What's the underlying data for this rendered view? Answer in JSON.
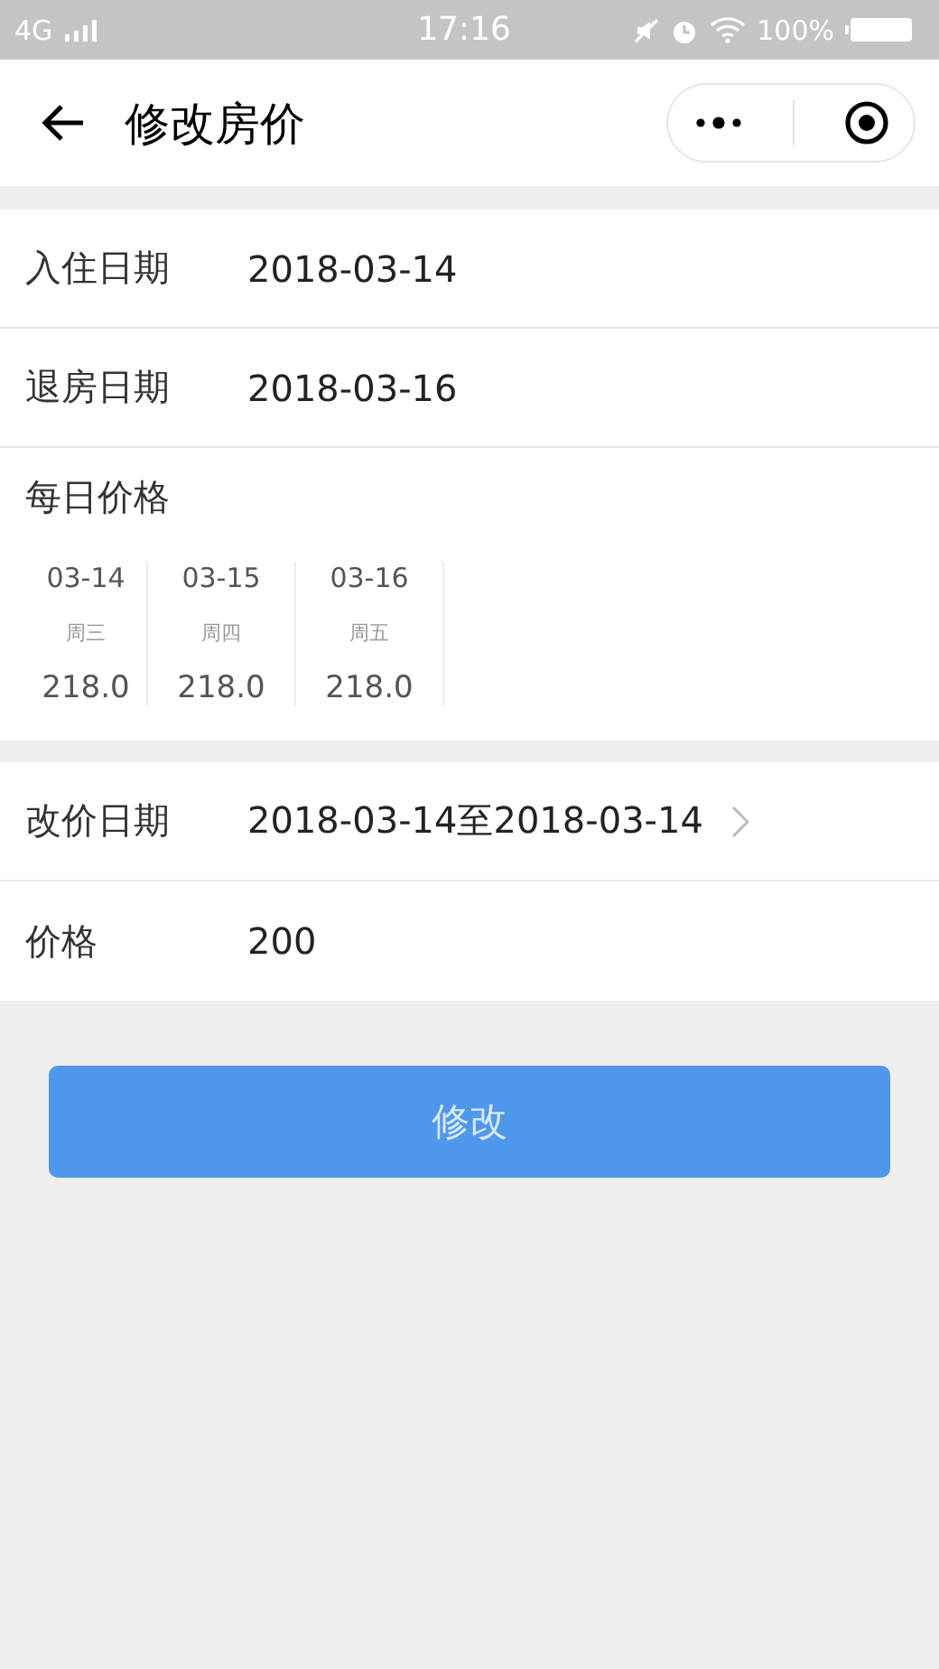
{
  "status_bar": {
    "network": "4G",
    "time": "17:16",
    "battery": "100%"
  },
  "nav": {
    "title": "修改房价"
  },
  "stay": [
    {
      "label": "入住日期",
      "value": "2018-03-14"
    },
    {
      "label": "退房日期",
      "value": "2018-03-16"
    }
  ],
  "daily_prices": {
    "label": "每日价格",
    "days": [
      {
        "date": "03-14",
        "weekday": "周三",
        "price": "218.0"
      },
      {
        "date": "03-15",
        "weekday": "周四",
        "price": "218.0"
      },
      {
        "date": "03-16",
        "weekday": "周五",
        "price": "218.0"
      }
    ]
  },
  "edit": [
    {
      "kind": "picker",
      "label": "改价日期",
      "value": "2018-03-14至2018-03-14"
    },
    {
      "kind": "input",
      "label": "价格",
      "value": "200"
    }
  ],
  "submit_button": "修改"
}
